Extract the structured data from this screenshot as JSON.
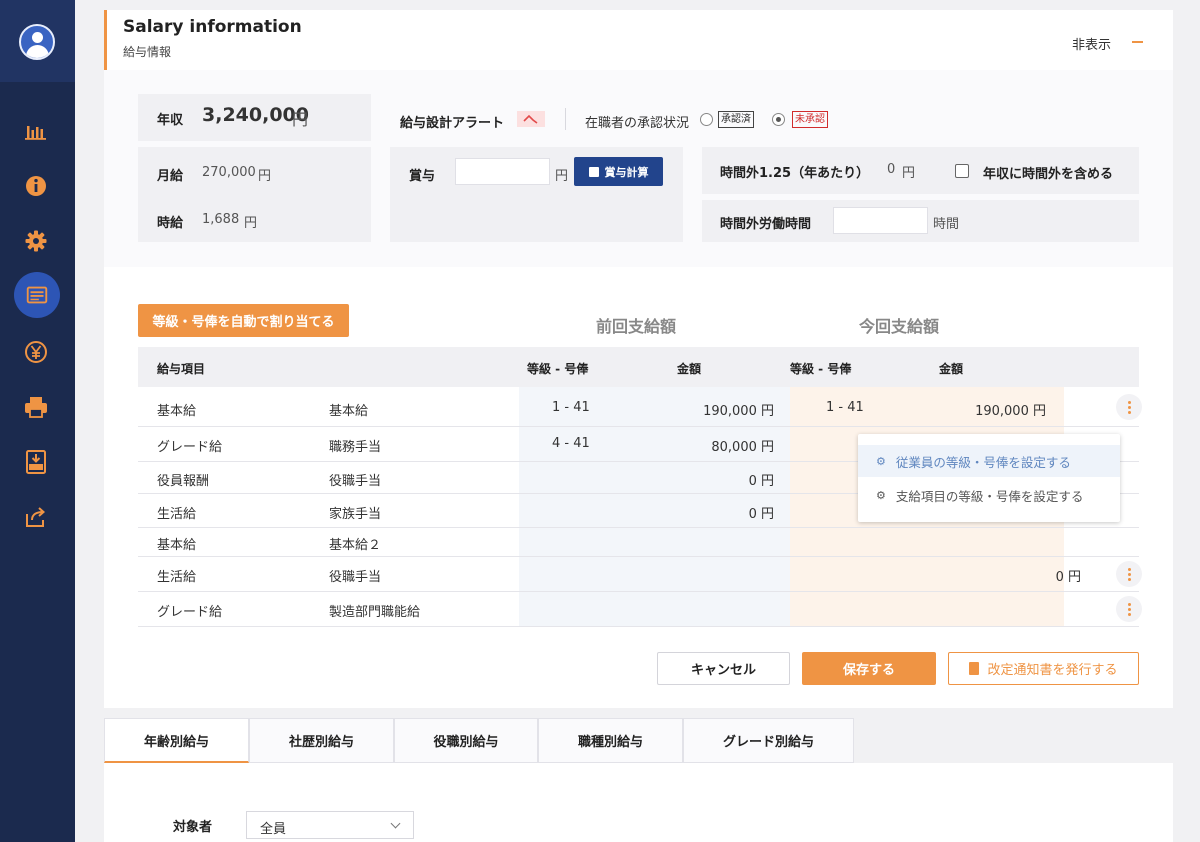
{
  "sidebar": {
    "items": [
      {
        "icon": "bar-chart-icon"
      },
      {
        "icon": "info-icon"
      },
      {
        "icon": "gear-icon"
      },
      {
        "icon": "list-icon",
        "active": true
      },
      {
        "icon": "yen-icon"
      },
      {
        "icon": "printer-icon"
      },
      {
        "icon": "csv-download-icon"
      },
      {
        "icon": "share-export-icon"
      }
    ],
    "accent": "#ef9444",
    "bg": "#1b2a4e"
  },
  "header": {
    "title": "Salary information",
    "subtitle": "給与情報",
    "hide_label": "非表示"
  },
  "summary": {
    "annual_label": "年収",
    "annual_value": "3,240,000",
    "annual_unit": "円",
    "monthly_label": "月給",
    "monthly_value": "270,000",
    "monthly_unit": "円",
    "hourly_label": "時給",
    "hourly_value": "1,688",
    "hourly_unit": "円",
    "alert_label": "給与設計アラート",
    "approval_label": "在職者の承認状況",
    "approval_options": [
      "承認済",
      "未承認"
    ],
    "approval_selected": "未承認",
    "bonus_label": "賞与",
    "bonus_value": "",
    "bonus_unit": "円",
    "bonus_calc_button": "賞与計算",
    "overtime_label": "時間外1.25（年あたり）",
    "overtime_value": "0",
    "overtime_unit": "円",
    "include_overtime_label": "年収に時間外を含める",
    "overtime_hours_label": "時間外労働時間",
    "overtime_hours_value": "",
    "overtime_hours_unit": "時間"
  },
  "table": {
    "auto_assign_button": "等級・号俸を自動で割り当てる",
    "prev_heading": "前回支給額",
    "curr_heading": "今回支給額",
    "headers": {
      "item": "給与項目",
      "prev_grade": "等級 - 号俸",
      "prev_amount": "金額",
      "curr_grade": "等級 - 号俸",
      "curr_amount": "金額"
    },
    "rows": [
      {
        "category": "基本給",
        "name": "基本給",
        "prev_grade": "1 - 41",
        "prev_amount": "190,000 円",
        "curr_grade": "1 - 41",
        "curr_amount": "190,000 円"
      },
      {
        "category": "グレード給",
        "name": "職務手当",
        "prev_grade": "4 - 41",
        "prev_amount": "80,000 円",
        "curr_grade": "",
        "curr_amount": ""
      },
      {
        "category": "役員報酬",
        "name": "役職手当",
        "prev_grade": "",
        "prev_amount": "0 円",
        "curr_grade": "",
        "curr_amount": ""
      },
      {
        "category": "生活給",
        "name": "家族手当",
        "prev_grade": "",
        "prev_amount": "0 円",
        "curr_grade": "",
        "curr_amount": ""
      },
      {
        "category": "基本給",
        "name": "基本給２",
        "prev_grade": "",
        "prev_amount": "",
        "curr_grade": "",
        "curr_amount": ""
      },
      {
        "category": "生活給",
        "name": "役職手当",
        "prev_grade": "",
        "prev_amount": "",
        "curr_grade": "",
        "curr_amount": "0 円"
      },
      {
        "category": "グレード給",
        "name": "製造部門職能給",
        "prev_grade": "",
        "prev_amount": "",
        "curr_grade": "",
        "curr_amount": ""
      }
    ],
    "popup_items": [
      "従業員の等級・号俸を設定する",
      "支給項目の等級・号俸を設定する"
    ]
  },
  "actions": {
    "cancel": "キャンセル",
    "save": "保存する",
    "issue_notice": "改定通知書を発行する"
  },
  "tabs": [
    {
      "label": "年齢別給与",
      "active": true
    },
    {
      "label": "社歴別給与"
    },
    {
      "label": "役職別給与"
    },
    {
      "label": "職種別給与"
    },
    {
      "label": "グレード別給与"
    }
  ],
  "filter": {
    "target_label": "対象者",
    "target_value": "全員"
  }
}
